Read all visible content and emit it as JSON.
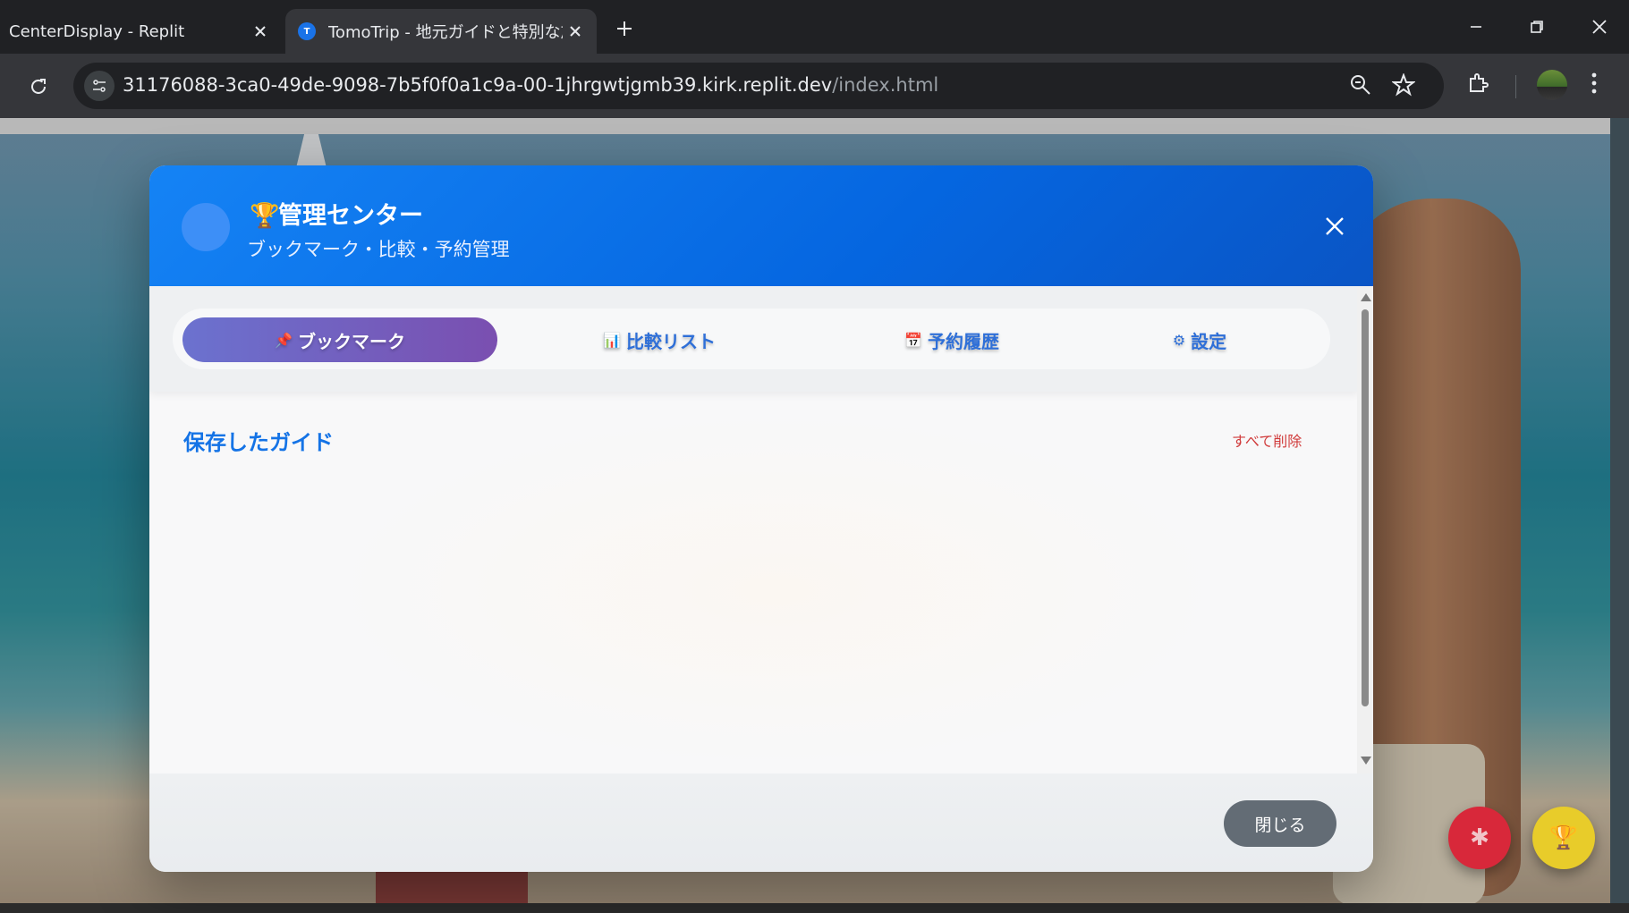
{
  "browser": {
    "tabs": [
      {
        "title": "CenterDisplay - Replit",
        "active": false
      },
      {
        "title": "TomoTrip - 地元ガイドと特別な旅",
        "active": true,
        "favicon_letter": "T"
      }
    ],
    "url_host": "31176088-3ca0-49de-9098-7b5f0f0a1c9a-00-1jhrgwtjgmb39.kirk.replit.dev",
    "url_path": "/index.html"
  },
  "modal": {
    "trophy_icon": "🏆",
    "title": "管理センター",
    "subtitle": "ブックマーク・比較・予約管理",
    "tabs": [
      {
        "icon": "📌",
        "label": "ブックマーク",
        "active": true
      },
      {
        "icon": "📊",
        "label": "比較リスト",
        "active": false
      },
      {
        "icon": "📅",
        "label": "予約履歴",
        "active": false
      },
      {
        "icon": "⚙",
        "label": "設定",
        "active": false
      }
    ],
    "section_title": "保存したガイド",
    "delete_all": "すべて削除",
    "close_button": "閉じる"
  },
  "floating": {
    "settings_icon": "✱",
    "trophy_icon": "🏆"
  },
  "colors": {
    "header_blue": "#0566e0",
    "accent_purple": "#7a4fb0",
    "danger": "#d03a3a",
    "fab_red": "#d8283a",
    "fab_yellow": "#e8cc2a"
  }
}
